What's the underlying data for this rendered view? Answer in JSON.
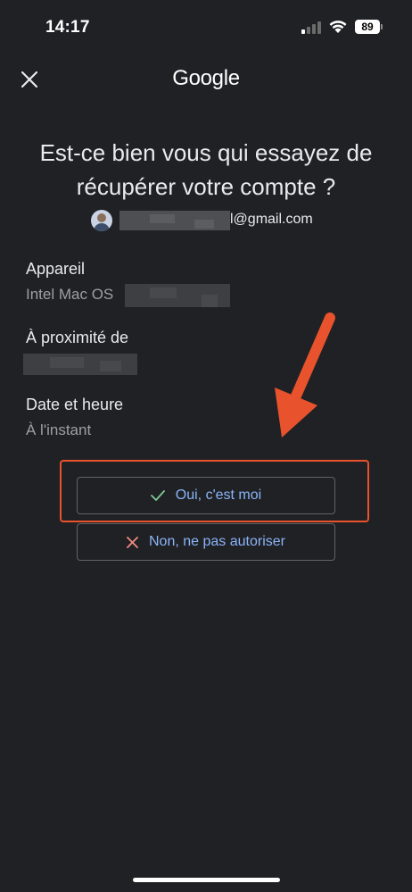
{
  "status_bar": {
    "time": "14:17",
    "battery": "89"
  },
  "header": {
    "close_icon": "close-icon",
    "brand": "Google"
  },
  "title": "Est-ce bien vous qui essayez de récupérer votre compte ?",
  "account": {
    "email_visible_suffix": "l@gmail.com"
  },
  "details": {
    "device": {
      "label": "Appareil",
      "value": "Intel Mac OS"
    },
    "location": {
      "label": "À proximité de"
    },
    "datetime": {
      "label": "Date et heure",
      "value": "À l'instant"
    }
  },
  "actions": {
    "confirm": {
      "label": "Oui, c'est moi",
      "icon": "check-icon",
      "icon_color": "#81c995"
    },
    "deny": {
      "label": "Non, ne pas autoriser",
      "icon": "x-icon",
      "icon_color": "#f28b82"
    }
  },
  "colors": {
    "background": "#202124",
    "link": "#8ab4f8",
    "annotation": "#e8522d"
  }
}
